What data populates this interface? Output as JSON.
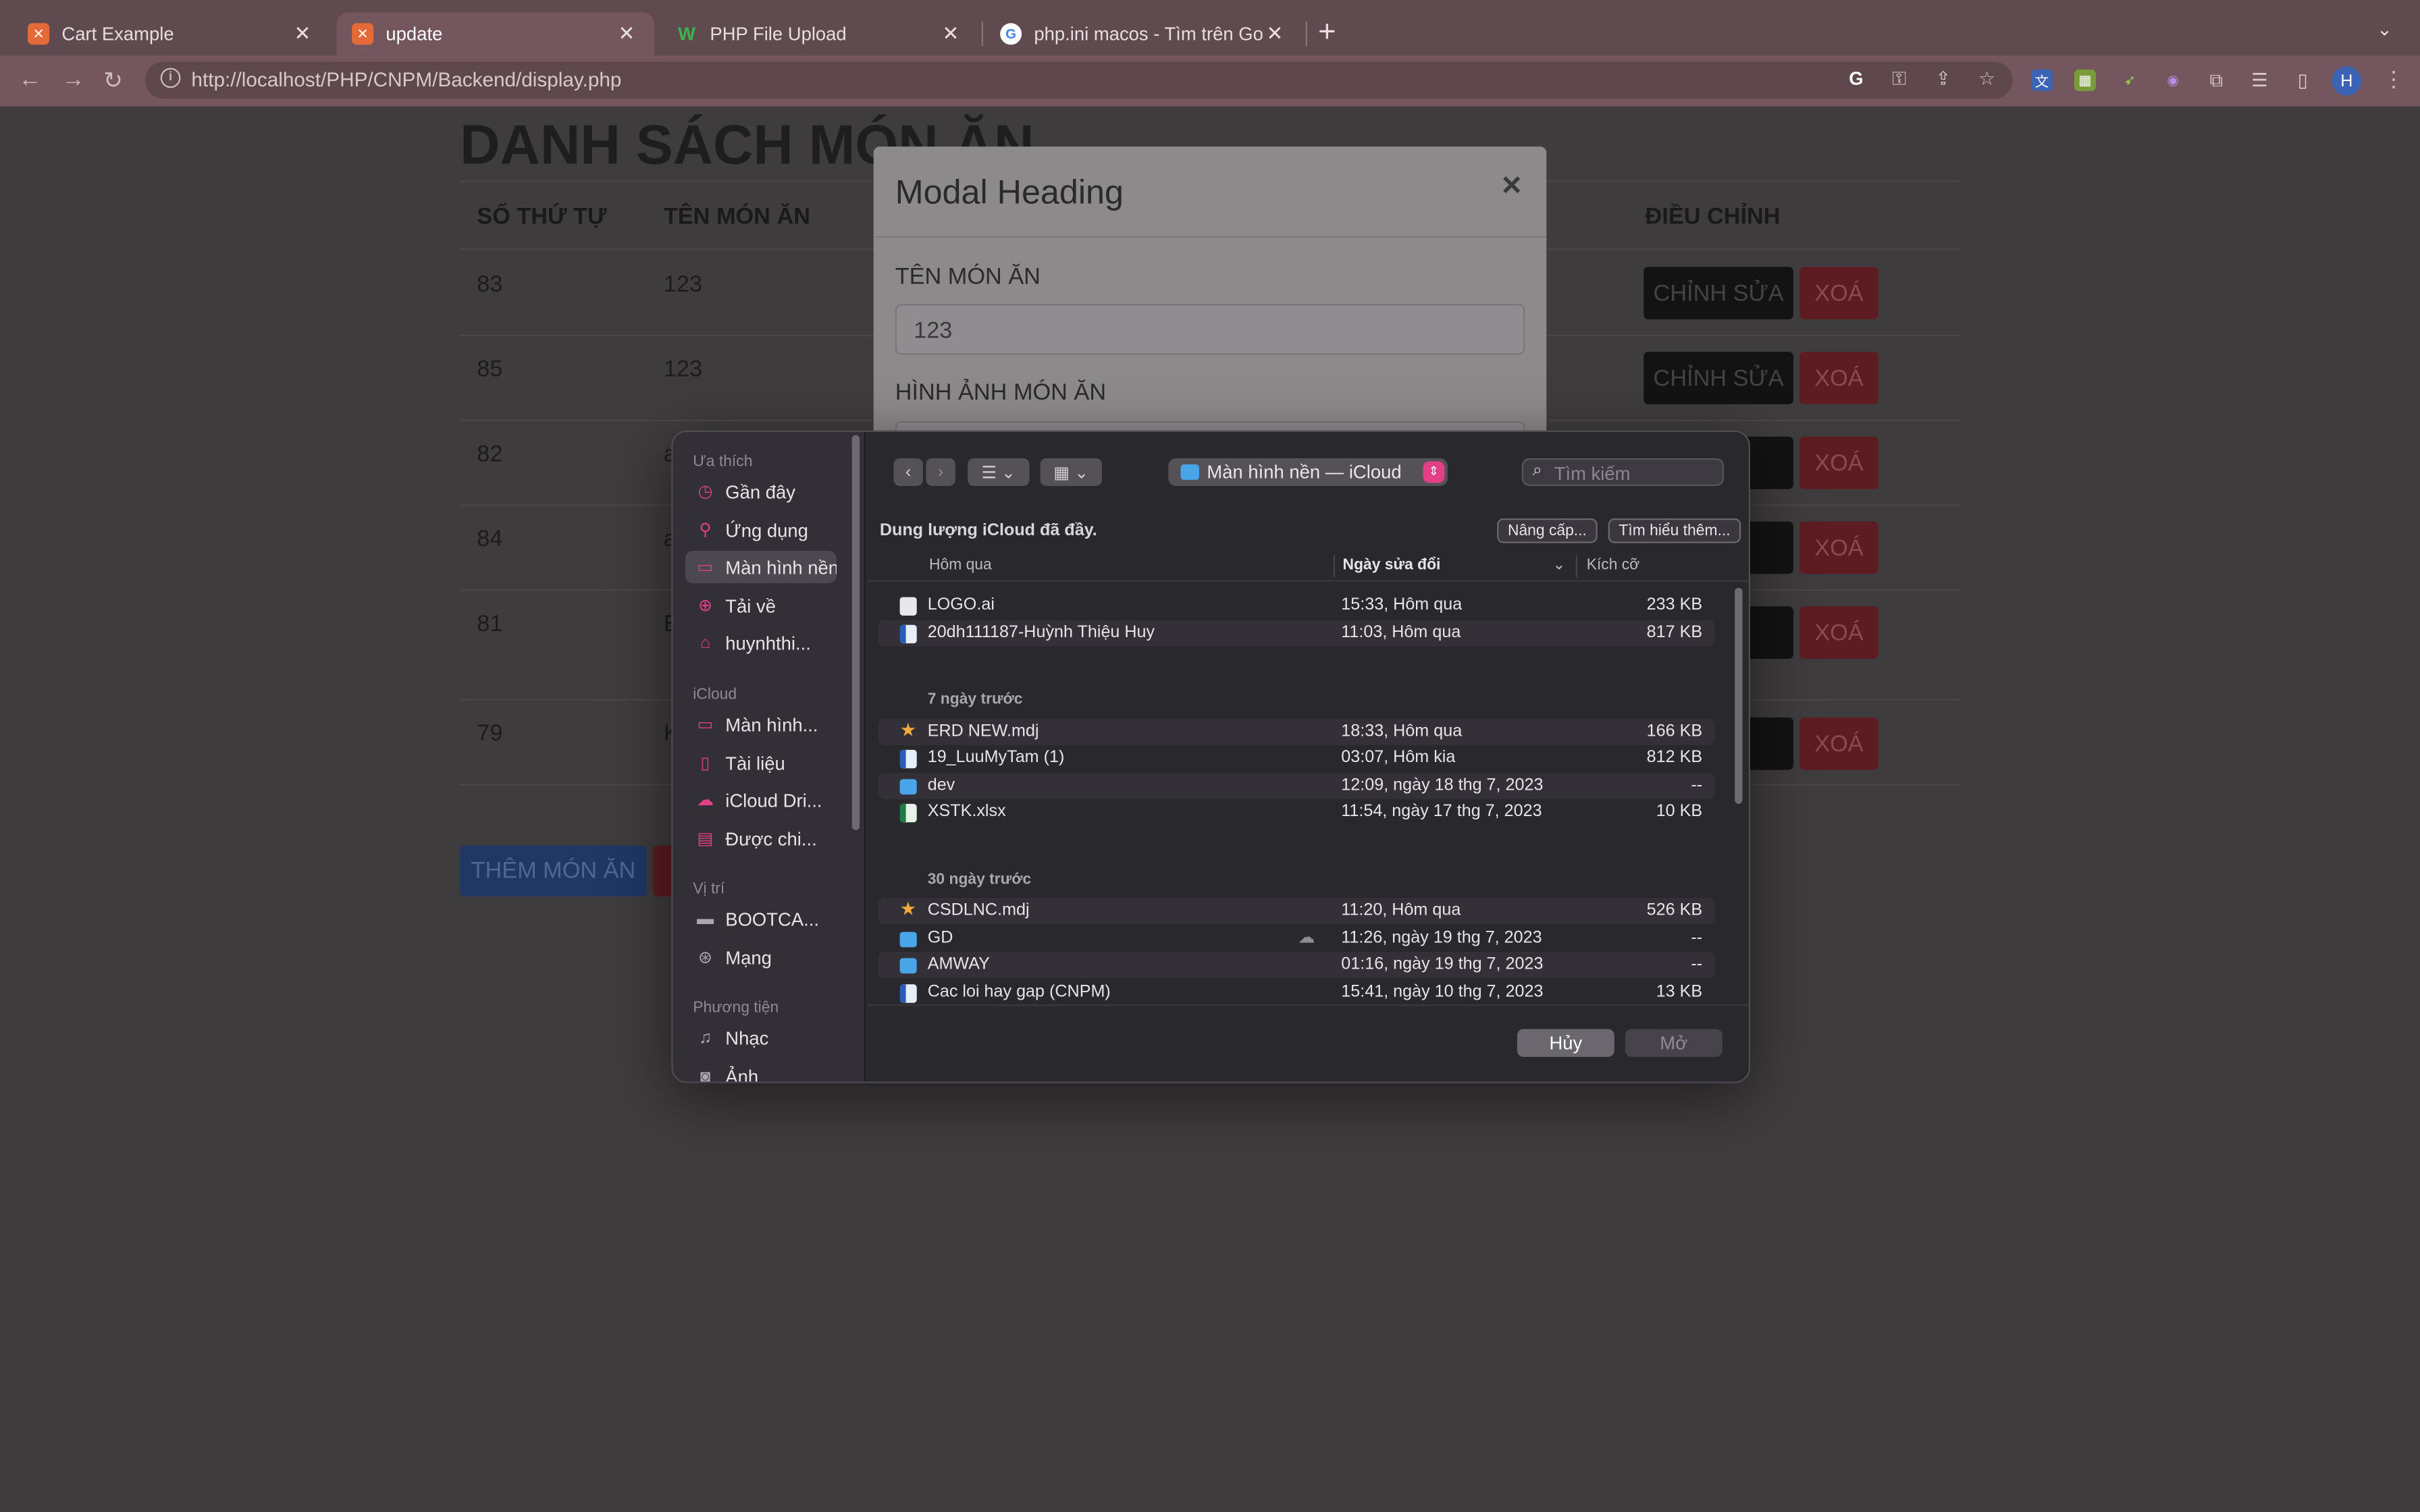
{
  "browser": {
    "tabs": [
      {
        "title": "Cart Example",
        "close": "✕"
      },
      {
        "title": "update",
        "close": "✕"
      },
      {
        "title": "PHP File Upload",
        "close": "✕"
      },
      {
        "title": "php.ini macos - Tìm trên Goog",
        "close": "✕"
      }
    ],
    "new_tab": "+",
    "url": "http://localhost/PHP/CNPM/Backend/display.php",
    "profile_initial": "H"
  },
  "page": {
    "title": "DANH SÁCH MÓN ĂN",
    "headers": {
      "col1": "SỐ THỨ TỰ",
      "col2": "TÊN MÓN ĂN",
      "col3": "ĐIỀU CHỈNH"
    },
    "rows": [
      {
        "id": "83",
        "name": "123"
      },
      {
        "id": "85",
        "name": "123"
      },
      {
        "id": "82",
        "name": "a"
      },
      {
        "id": "84",
        "name": "a"
      },
      {
        "id": "81",
        "name": "B"
      },
      {
        "id": "79",
        "name": "K"
      }
    ],
    "edit_label": "CHỈNH SỬA",
    "edit_partial": "SỬA",
    "delete_label": "XOÁ",
    "add_label": "THÊM MÓN ĂN"
  },
  "modal": {
    "heading": "Modal Heading",
    "close": "×",
    "name_label": "TÊN MÓN ĂN",
    "name_value": "123",
    "image_label": "HÌNH ẢNH MÓN ĂN"
  },
  "dialog": {
    "sidebar": {
      "favorites_label": "Ưa thích",
      "favorites": [
        "Gần đây",
        "Ứng dụng",
        "Màn hình nền",
        "Tải về",
        "huynhthi..."
      ],
      "icloud_label": "iCloud",
      "icloud": [
        "Màn hình...",
        "Tài liệu",
        "iCloud Dri...",
        "Được chi..."
      ],
      "locations_label": "Vị trí",
      "locations": [
        "BOOTCA...",
        "Mạng"
      ],
      "media_label": "Phương tiện",
      "media": [
        "Nhạc",
        "Ảnh"
      ]
    },
    "location": "Màn hình nền — iCloud",
    "search_placeholder": "Tìm kiếm",
    "icloud_full": "Dung lượng iCloud đã đầy.",
    "upgrade_button": "Nâng cấp...",
    "learn_more_button": "Tìm hiểu thêm...",
    "columns": {
      "name": "Hôm qua",
      "date": "Ngày sửa đổi",
      "size": "Kích cỡ"
    },
    "groups": [
      {
        "label": "Hôm qua",
        "files": [
          {
            "name": "LOGO.ai",
            "date": "15:33, Hôm qua",
            "size": "233 KB",
            "kind": "doc"
          },
          {
            "name": "20dh111187-Huỳnh Thiệu Huy",
            "date": "11:03, Hôm qua",
            "size": "817 KB",
            "kind": "word"
          }
        ]
      },
      {
        "label": "7 ngày trước",
        "files": [
          {
            "name": "ERD NEW.mdj",
            "date": "18:33, Hôm qua",
            "size": "166 KB",
            "kind": "star"
          },
          {
            "name": "19_LuuMyTam (1)",
            "date": "03:07, Hôm kia",
            "size": "812 KB",
            "kind": "word"
          },
          {
            "name": "dev",
            "date": "12:09, ngày 18 thg 7, 2023",
            "size": "--",
            "kind": "folder"
          },
          {
            "name": "XSTK.xlsx",
            "date": "11:54, ngày 17 thg 7, 2023",
            "size": "10 KB",
            "kind": "excel"
          }
        ]
      },
      {
        "label": "30 ngày trước",
        "files": [
          {
            "name": "CSDLNC.mdj",
            "date": "11:20, Hôm qua",
            "size": "526 KB",
            "kind": "star"
          },
          {
            "name": "GD",
            "date": "11:26, ngày 19 thg 7, 2023",
            "size": "--",
            "kind": "folder",
            "cloud": true
          },
          {
            "name": "AMWAY",
            "date": "01:16, ngày 19 thg 7, 2023",
            "size": "--",
            "kind": "folder"
          },
          {
            "name": "Cac loi hay gap (CNPM)",
            "date": "15:41, ngày 10 thg 7, 2023",
            "size": "13 KB",
            "kind": "word"
          }
        ]
      }
    ],
    "cancel_button": "Hủy",
    "open_button": "Mở"
  }
}
